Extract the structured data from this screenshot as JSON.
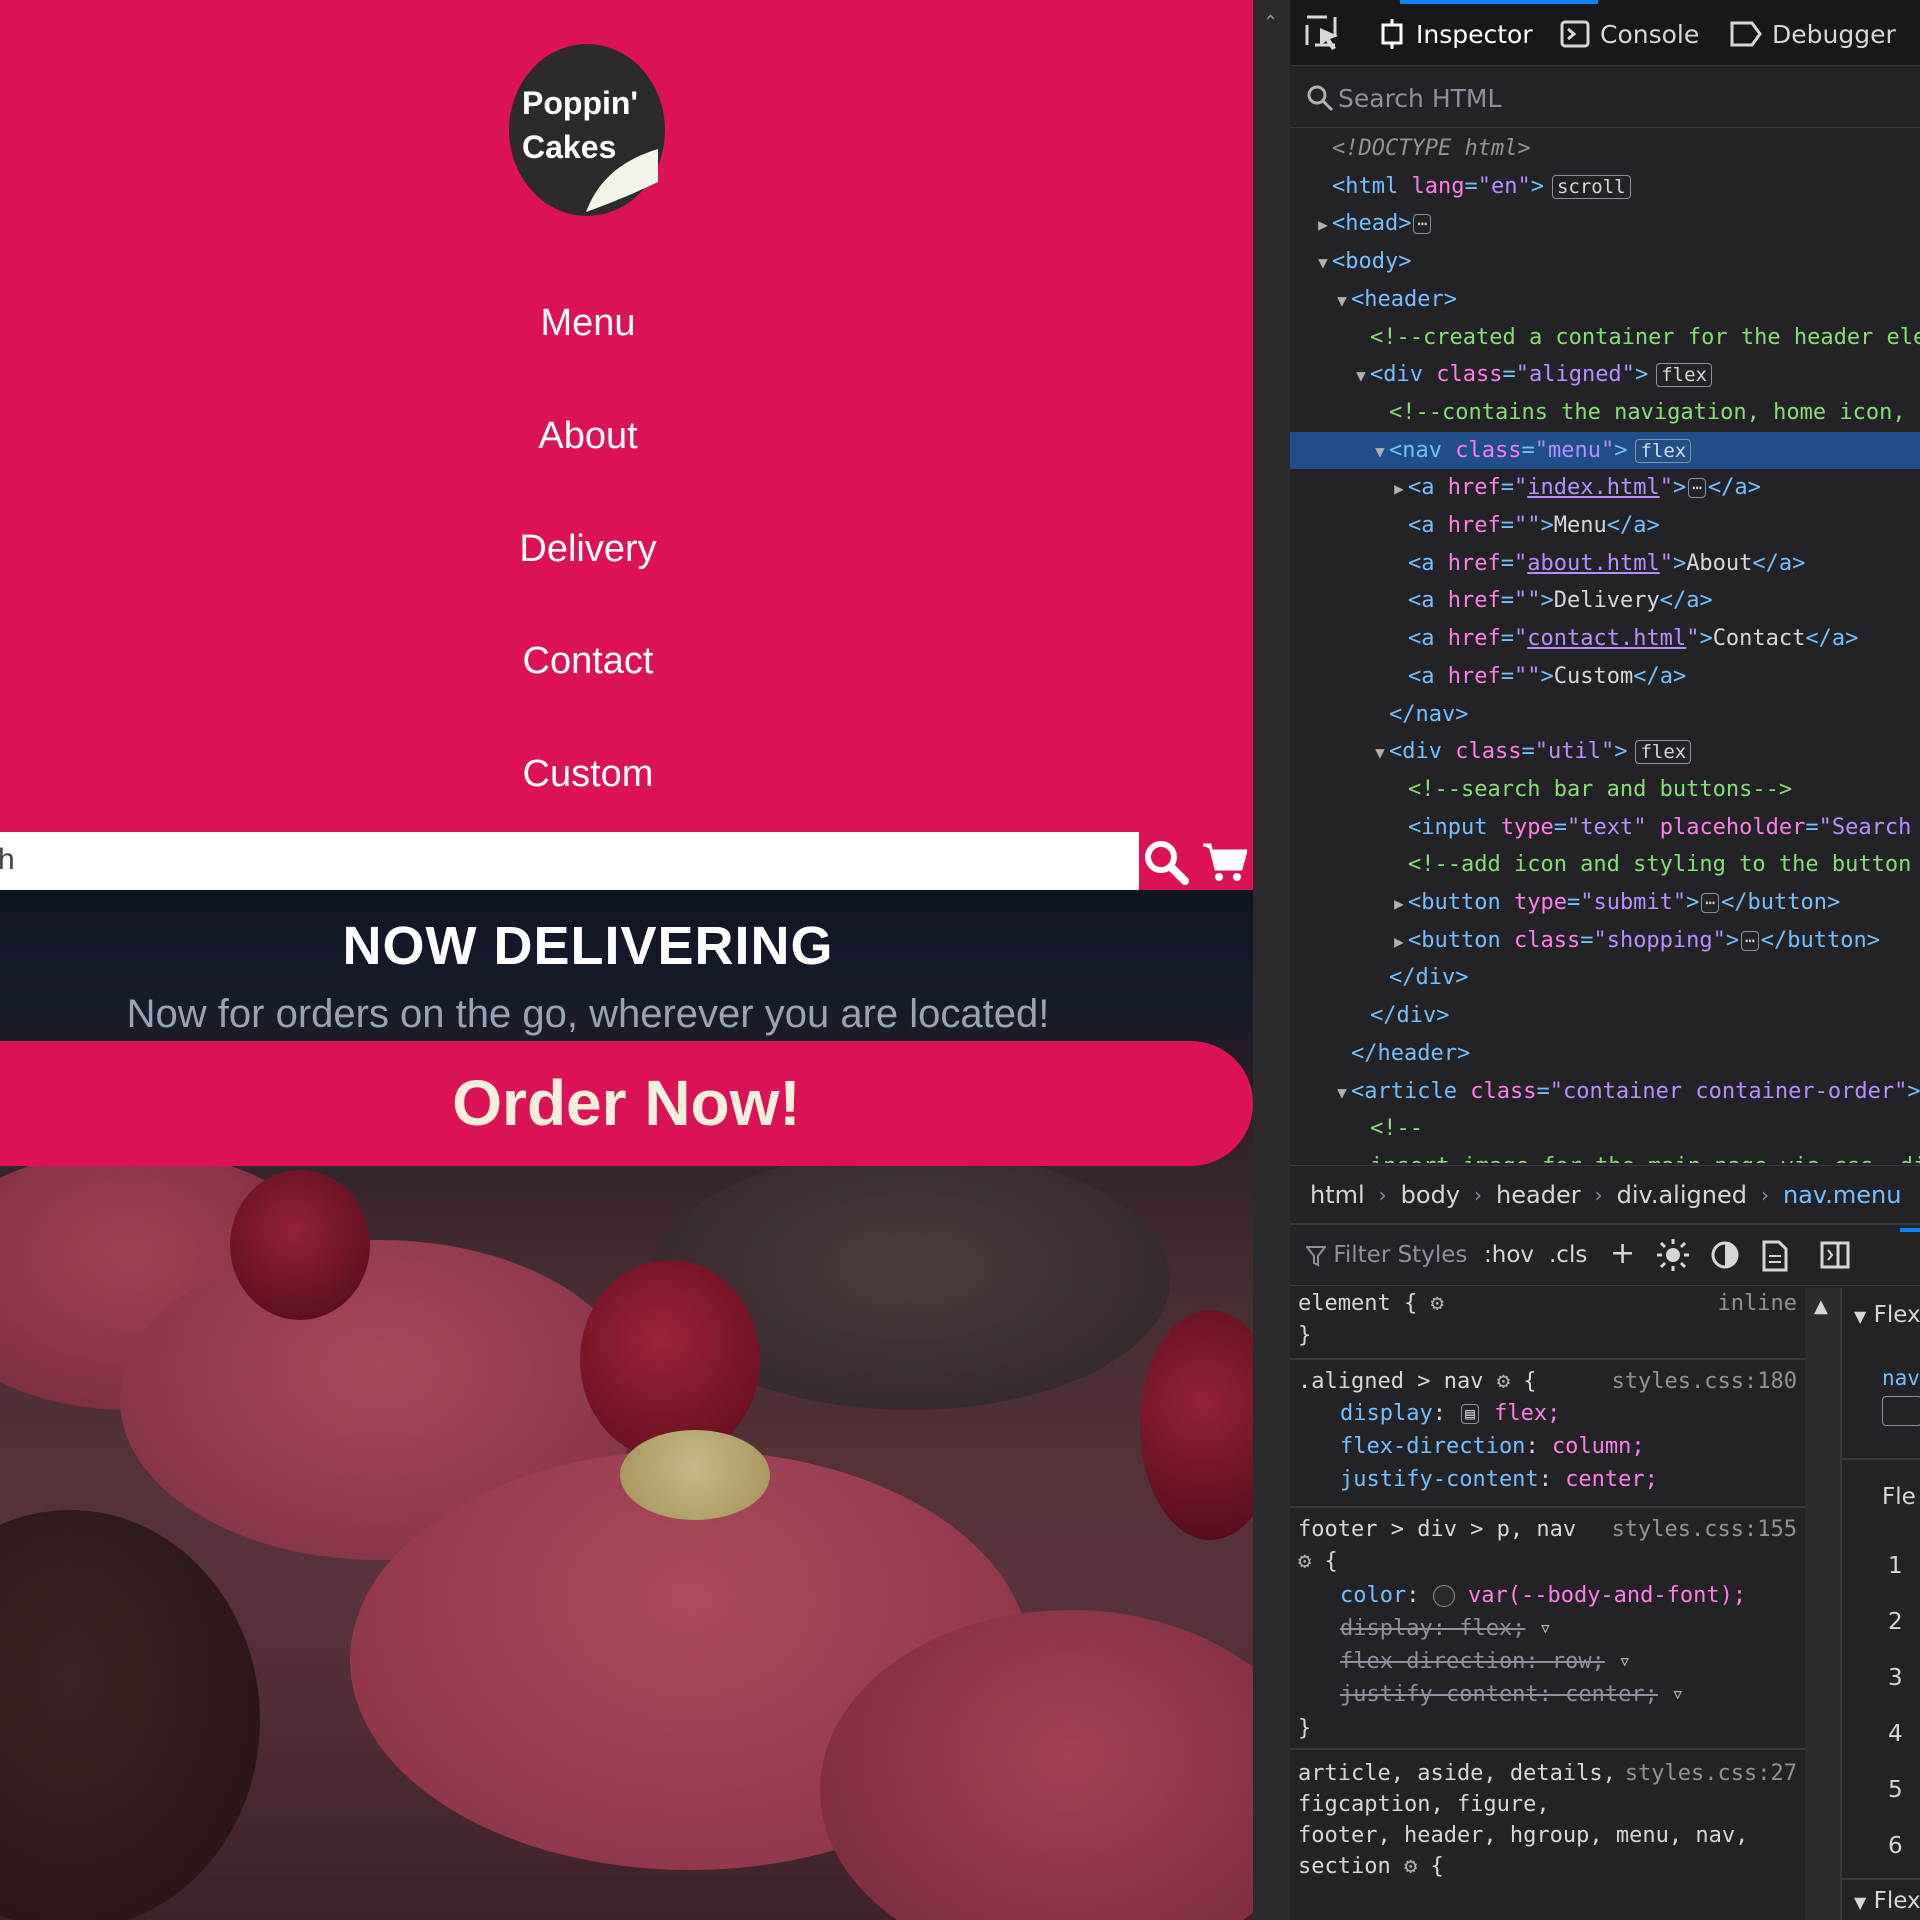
{
  "site": {
    "logo_line1": "Poppin'",
    "logo_line2": "Cakes",
    "nav": [
      "Menu",
      "About",
      "Delivery",
      "Contact",
      "Custom"
    ],
    "search_value": "h",
    "hero_title": "NOW DELIVERING",
    "hero_subtitle": "Now for orders on the go, wherever you are located!",
    "order_button": "Order Now!",
    "colors": {
      "brand": "#dc1256",
      "order_text": "#f4efdc"
    }
  },
  "devtools": {
    "tabs": [
      "Inspector",
      "Console",
      "Debugger"
    ],
    "search_placeholder": "Search HTML",
    "markup": [
      {
        "doctype": "<!DOCTYPE html>"
      },
      {
        "open": "<html",
        "attr": "lang",
        "val": "\"en\"",
        "close": ">",
        "badge": "scroll"
      },
      {
        "open": "<head>",
        "ellipsis": true,
        "close": "</head>"
      },
      {
        "open": "<body>"
      },
      {
        "open": "<header>"
      },
      {
        "comment": "<!--created a container for the header ele"
      },
      {
        "open": "<div",
        "attr": "class",
        "val": "\"aligned\"",
        "close": ">",
        "badge": "flex"
      },
      {
        "comment": "<!--contains the navigation, home icon, "
      },
      {
        "open": "<nav",
        "attr": "class",
        "val": "\"menu\"",
        "close": ">",
        "badge": "flex"
      },
      {
        "open": "<a",
        "attr": "href",
        "link": "index.html",
        "close": ">",
        "ellipsis": true,
        "end": "</a>"
      },
      {
        "open": "<a",
        "attr": "href",
        "val": "\"\"",
        "close": ">",
        "text": "Menu",
        "end": "</a>"
      },
      {
        "open": "<a",
        "attr": "href",
        "link": "about.html",
        "close": ">",
        "text": "About",
        "end": "</a>"
      },
      {
        "open": "<a",
        "attr": "href",
        "val": "\"\"",
        "close": ">",
        "text": "Delivery",
        "end": "</a>"
      },
      {
        "open": "<a",
        "attr": "href",
        "link": "contact.html",
        "close": ">",
        "text": "Contact",
        "end": "</a>"
      },
      {
        "open": "<a",
        "attr": "href",
        "val": "\"\"",
        "close": ">",
        "text": "Custom",
        "end": "</a>"
      },
      {
        "end": "</nav>"
      },
      {
        "open": "<div",
        "attr": "class",
        "val": "\"util\"",
        "close": ">",
        "badge": "flex"
      },
      {
        "comment": "<!--search bar and buttons-->"
      },
      {
        "open": "<input",
        "attr": "type",
        "val": "\"text\"",
        "attr2": "placeholder",
        "val2": "\"Search"
      },
      {
        "comment": "<!--add icon and styling to the button"
      },
      {
        "open": "<button",
        "attr": "type",
        "val": "\"submit\"",
        "close": ">",
        "ellipsis": true,
        "end": "</button>"
      },
      {
        "open": "<button",
        "attr": "class",
        "val": "\"shopping\"",
        "close": ">",
        "ellipsis": true,
        "end": "</button>"
      },
      {
        "end": "</div>"
      },
      {
        "end": "</div>"
      },
      {
        "end": "</header>"
      },
      {
        "open": "<article",
        "attr": "class",
        "val": "\"container container-order\"",
        "close": ">"
      },
      {
        "comment": "<!--"
      },
      {
        "comment": "insert image for the main page via css. di"
      }
    ],
    "breadcrumbs": [
      "html",
      "body",
      "header",
      "div.aligned",
      "nav.menu"
    ],
    "rules_toolbar": {
      "filter": "Filter Styles",
      "hov": ":hov",
      "cls": ".cls"
    },
    "rules": {
      "element_selector": "element {",
      "element_source": "inline",
      "r1_selector": ".aligned > nav",
      "r1_source": "styles.css:180",
      "r1_props": [
        {
          "p": "display",
          "v": "flex;"
        },
        {
          "p": "flex-direction",
          "v": "column;"
        },
        {
          "p": "justify-content",
          "v": "center;"
        }
      ],
      "r2_selector": "footer > div > p, nav",
      "r2_source": "styles.css:155",
      "r2_color": "color",
      "r2_color_val": "var(--body-and-font);",
      "r2_struck": [
        "display: flex;",
        "flex-direction: row;",
        "justify-content: center;"
      ],
      "r3_lines": [
        "article, aside, details,",
        "figcaption, figure,",
        "footer, header, hgroup, menu, nav,",
        "section"
      ],
      "r3_source": "styles.css:27"
    },
    "right_pane": {
      "head": "Flex",
      "item": "nav",
      "label": "Fle",
      "numbers": [
        "1",
        "2",
        "3",
        "4",
        "5",
        "6"
      ],
      "foot": "Flex"
    }
  }
}
